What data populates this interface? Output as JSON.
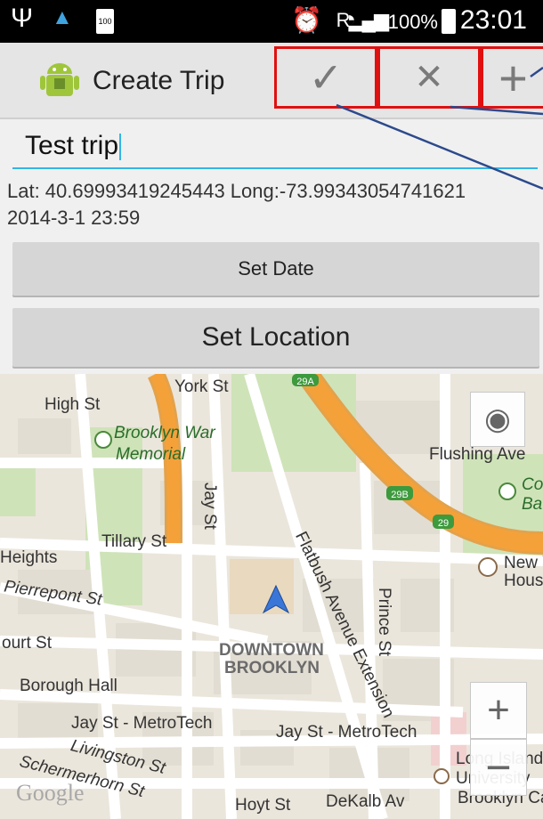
{
  "status_bar": {
    "time": "23:01",
    "battery_percent": "100%",
    "small_battery_label": "100",
    "signal_label": "R"
  },
  "action_bar": {
    "title": "Create Trip",
    "done_glyph": "✓",
    "cancel_glyph": "✕",
    "add_glyph": "+"
  },
  "form": {
    "trip_name_value": "Test trip",
    "lat_long": "Lat: 40.69993419245443 Long:-73.99343054741621",
    "datetime": "2014-3-1 23:59",
    "set_date_label": "Set Date",
    "set_location_label": "Set Location"
  },
  "map": {
    "labels": {
      "york_st": "York St",
      "high_st": "High St",
      "brooklyn_war_1": "Brooklyn War",
      "brooklyn_war_2": "Memorial",
      "flushing_ave": "Flushing Ave",
      "jay_st": "Jay St",
      "tillary_st": "Tillary St",
      "heights": "Heights",
      "flatbush": "Flatbush Avenue Extension",
      "pierrepont": "Pierrepont St",
      "court_st": "ourt St",
      "prince_st": "Prince St",
      "downtown_1": "DOWNTOWN",
      "downtown_2": "BROOKLYN",
      "new_housing_1": "New Y",
      "new_housing_2": "Housi",
      "borough_hall": "Borough Hall",
      "jay_metrotech_1": "Jay St - MetroTech",
      "jay_metrotech_2": "Jay St - MetroTech",
      "livingston": "Livingston St",
      "schermerhorn": "Schermerhorn St",
      "hoyt": "Hoyt St",
      "dekalb": "DeKalb Av",
      "liu_1": "Long Island",
      "liu_2": "University",
      "liu_3": "Brooklyn Ca",
      "co_1": "Co",
      "co_2": "Ba",
      "r29a": "29A",
      "r29b": "29B",
      "r29": "29",
      "google": "Google"
    }
  },
  "colors": {
    "annotation_box": "#e01010",
    "annotation_line": "#2c4a8c",
    "field_underline": "#33b5e5",
    "highway": "#f5a13a",
    "park": "#cfe3b9",
    "building": "#ebe6dc"
  }
}
